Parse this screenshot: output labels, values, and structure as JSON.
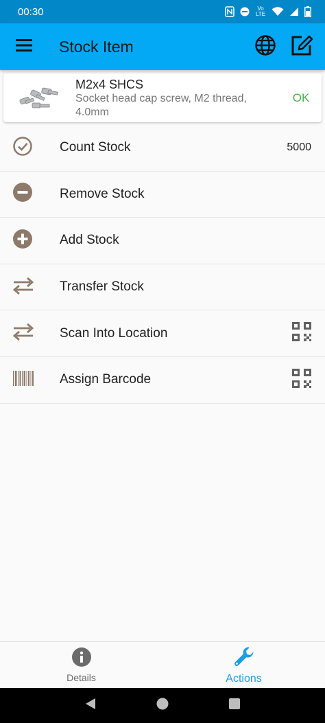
{
  "status_bar": {
    "time": "00:30",
    "network_label": "Vo LTE"
  },
  "app_bar": {
    "title": "Stock Item"
  },
  "item": {
    "name": "M2x4 SHCS",
    "description": "Socket head cap screw, M2 thread, 4.0mm",
    "status": "OK"
  },
  "actions": [
    {
      "label": "Count Stock",
      "value": "5000"
    },
    {
      "label": "Remove Stock"
    },
    {
      "label": "Add Stock"
    },
    {
      "label": "Transfer Stock"
    },
    {
      "label": "Scan Into Location"
    },
    {
      "label": "Assign Barcode"
    }
  ],
  "bottom_nav": {
    "details": "Details",
    "actions": "Actions"
  },
  "colors": {
    "primary": "#03a9f4",
    "icon_brown": "#8d7a6b",
    "active": "#1e9ee0",
    "ok_green": "#4caf50"
  }
}
